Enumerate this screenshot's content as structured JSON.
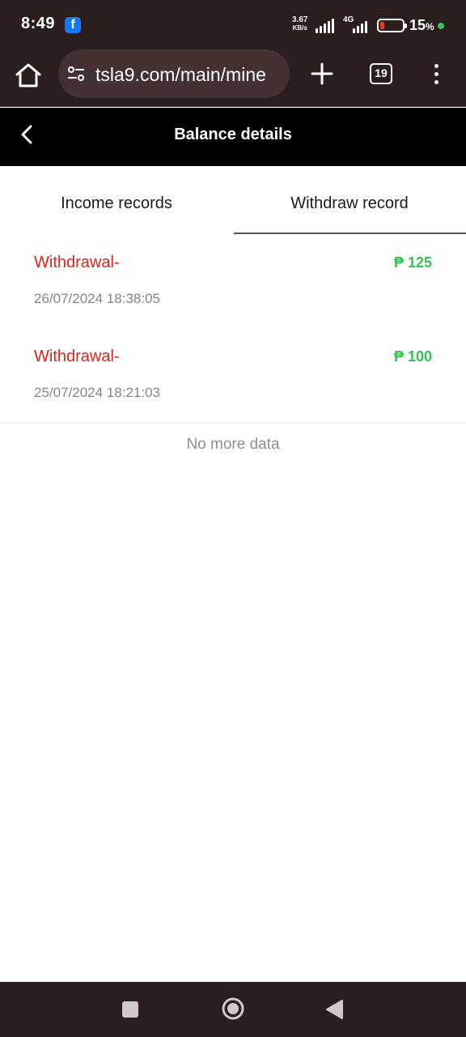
{
  "status": {
    "time": "8:49",
    "app_badge": "f",
    "speed_value": "3.67",
    "speed_unit": "KB/s",
    "network_type": "4G",
    "battery": "15",
    "battery_unit": "%"
  },
  "browser": {
    "url": "tsla9.com/main/mine",
    "tab_count": "19"
  },
  "header": {
    "title": "Balance details"
  },
  "tabs": [
    {
      "label": "Income records"
    },
    {
      "label": "Withdraw record"
    }
  ],
  "records": [
    {
      "label": "Withdrawal-",
      "amount": "₱ 125",
      "time": "26/07/2024 18:38:05"
    },
    {
      "label": "Withdrawal-",
      "amount": "₱ 100",
      "time": "25/07/2024 18:21:03"
    }
  ],
  "footer_text": "No more data",
  "colors": {
    "withdraw_label": "#d9261c",
    "amount": "#3bbd57",
    "chrome_bg": "#2a1f1d"
  }
}
